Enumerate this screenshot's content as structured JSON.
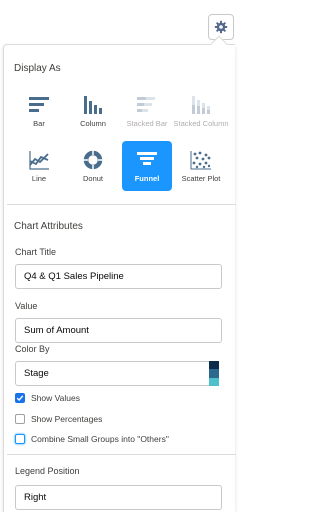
{
  "colors": {
    "accent": "#1b96ff",
    "checkbox_checked": "#1a73e8",
    "tile_icon": "#4a6d8c",
    "tile_icon_disabled": "#c3ccd6",
    "color_by_swatches": [
      "#0b2c4a",
      "#2b6a8c",
      "#4dc0cc"
    ]
  },
  "toolbar": {
    "settings_icon": "gear-icon"
  },
  "display_as": {
    "title": "Display As",
    "options": [
      {
        "label": "Bar",
        "icon": "bar-chart-icon",
        "state": "enabled"
      },
      {
        "label": "Column",
        "icon": "column-chart-icon",
        "state": "enabled"
      },
      {
        "label": "Stacked Bar",
        "icon": "stacked-bar-chart-icon",
        "state": "disabled"
      },
      {
        "label": "Stacked Column",
        "icon": "stacked-column-chart-icon",
        "state": "disabled"
      },
      {
        "label": "Line",
        "icon": "line-chart-icon",
        "state": "enabled"
      },
      {
        "label": "Donut",
        "icon": "donut-chart-icon",
        "state": "enabled"
      },
      {
        "label": "Funnel",
        "icon": "funnel-chart-icon",
        "state": "selected"
      },
      {
        "label": "Scatter Plot",
        "icon": "scatter-plot-icon",
        "state": "enabled"
      }
    ]
  },
  "chart_attributes": {
    "title": "Chart Attributes",
    "chart_title": {
      "label": "Chart Title",
      "value": "Q4 & Q1 Sales Pipeline"
    },
    "value": {
      "label": "Value",
      "value": "Sum of Amount"
    },
    "color_by": {
      "label": "Color By",
      "value": "Stage"
    },
    "checkboxes": [
      {
        "label": "Show Values",
        "checked": true
      },
      {
        "label": "Show Percentages",
        "checked": false
      },
      {
        "label": "Combine Small Groups into \"Others\"",
        "checked": false,
        "focused": true
      }
    ],
    "legend_position": {
      "label": "Legend Position",
      "value": "Right"
    }
  }
}
